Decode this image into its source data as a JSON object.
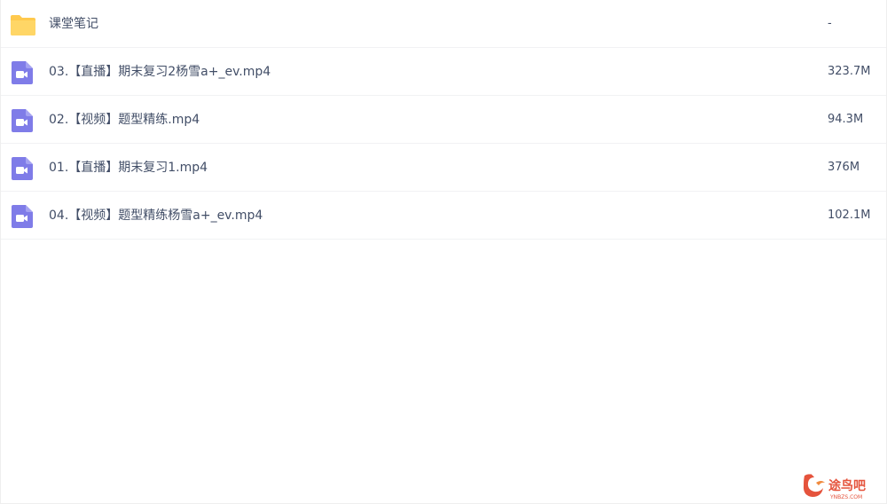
{
  "files": [
    {
      "name": "课堂笔记",
      "size": "-",
      "type": "folder",
      "icon": "folder-icon"
    },
    {
      "name": "03.【直播】期末复习2杨雪a+_ev.mp4",
      "size": "323.7M",
      "type": "video",
      "icon": "video-file-icon"
    },
    {
      "name": "02.【视频】题型精练.mp4",
      "size": "94.3M",
      "type": "video",
      "icon": "video-file-icon"
    },
    {
      "name": "01.【直播】期末复习1.mp4",
      "size": "376M",
      "type": "video",
      "icon": "video-file-icon"
    },
    {
      "name": "04.【视频】题型精练杨雪a+_ev.mp4",
      "size": "102.1M",
      "type": "video",
      "icon": "video-file-icon"
    }
  ],
  "watermark": {
    "text": "途鸟吧",
    "subtext": "YNBZS.COM"
  },
  "colors": {
    "folder": "#ffc94d",
    "video": "#7f7ce8",
    "text": "#424e67",
    "divider": "#f1f2f4",
    "watermark": "#e5533c"
  }
}
